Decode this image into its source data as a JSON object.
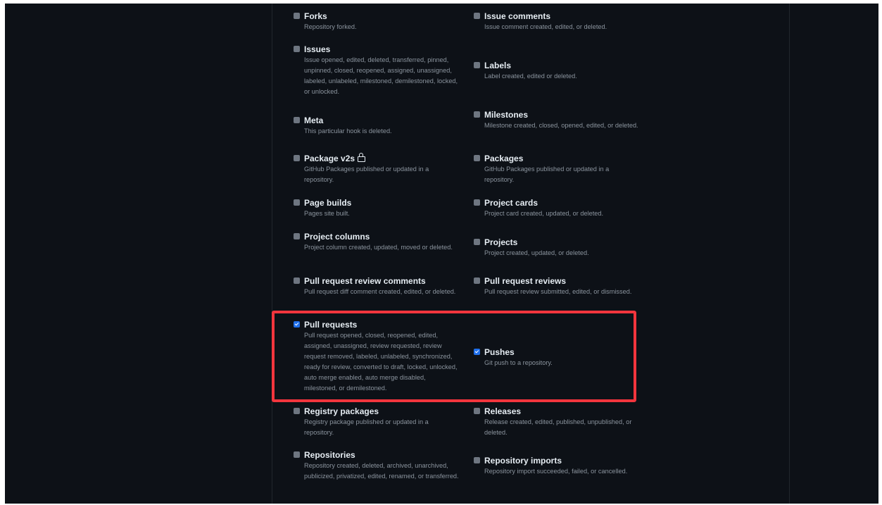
{
  "events": {
    "forks": {
      "title": "Forks",
      "desc": "Repository forked."
    },
    "issue_comments": {
      "title": "Issue comments",
      "desc": "Issue comment created, edited, or deleted."
    },
    "issues": {
      "title": "Issues",
      "desc": "Issue opened, edited, deleted, transferred, pinned, unpinned, closed, reopened, assigned, unassigned, labeled, unlabeled, milestoned, demilestoned, locked, or unlocked."
    },
    "labels": {
      "title": "Labels",
      "desc": "Label created, edited or deleted."
    },
    "meta": {
      "title": "Meta",
      "desc": "This particular hook is deleted."
    },
    "milestones": {
      "title": "Milestones",
      "desc": "Milestone created, closed, opened, edited, or deleted."
    },
    "package_v2s": {
      "title": "Package v2s",
      "desc": "GitHub Packages published or updated in a repository."
    },
    "packages": {
      "title": "Packages",
      "desc": "GitHub Packages published or updated in a repository."
    },
    "page_builds": {
      "title": "Page builds",
      "desc": "Pages site built."
    },
    "project_cards": {
      "title": "Project cards",
      "desc": "Project card created, updated, or deleted."
    },
    "project_columns": {
      "title": "Project columns",
      "desc": "Project column created, updated, moved or deleted."
    },
    "projects": {
      "title": "Projects",
      "desc": "Project created, updated, or deleted."
    },
    "pr_review_comments": {
      "title": "Pull request review comments",
      "desc": "Pull request diff comment created, edited, or deleted."
    },
    "pr_reviews": {
      "title": "Pull request reviews",
      "desc": "Pull request review submitted, edited, or dismissed."
    },
    "pull_requests": {
      "title": "Pull requests",
      "desc": "Pull request opened, closed, reopened, edited, assigned, unassigned, review requested, review request removed, labeled, unlabeled, synchronized, ready for review, converted to draft, locked, unlocked, auto merge enabled, auto merge disabled, milestoned, or demilestoned.",
      "checked": true
    },
    "pushes": {
      "title": "Pushes",
      "desc": "Git push to a repository.",
      "checked": true
    },
    "registry_packages": {
      "title": "Registry packages",
      "desc": "Registry package published or updated in a repository."
    },
    "releases": {
      "title": "Releases",
      "desc": "Release created, edited, published, unpublished, or deleted."
    },
    "repositories": {
      "title": "Repositories",
      "desc": "Repository created, deleted, archived, unarchived, publicized, privatized, edited, renamed, or transferred."
    },
    "repository_imports": {
      "title": "Repository imports",
      "desc": "Repository import succeeded, failed, or cancelled."
    }
  },
  "colors": {
    "background": "#0d1117",
    "checkbox_checked": "#1f6feb",
    "checkbox_unchecked": "#6e7681",
    "highlight": "#f2353d"
  },
  "icons": {
    "package_v2s_title": "lock-icon"
  }
}
